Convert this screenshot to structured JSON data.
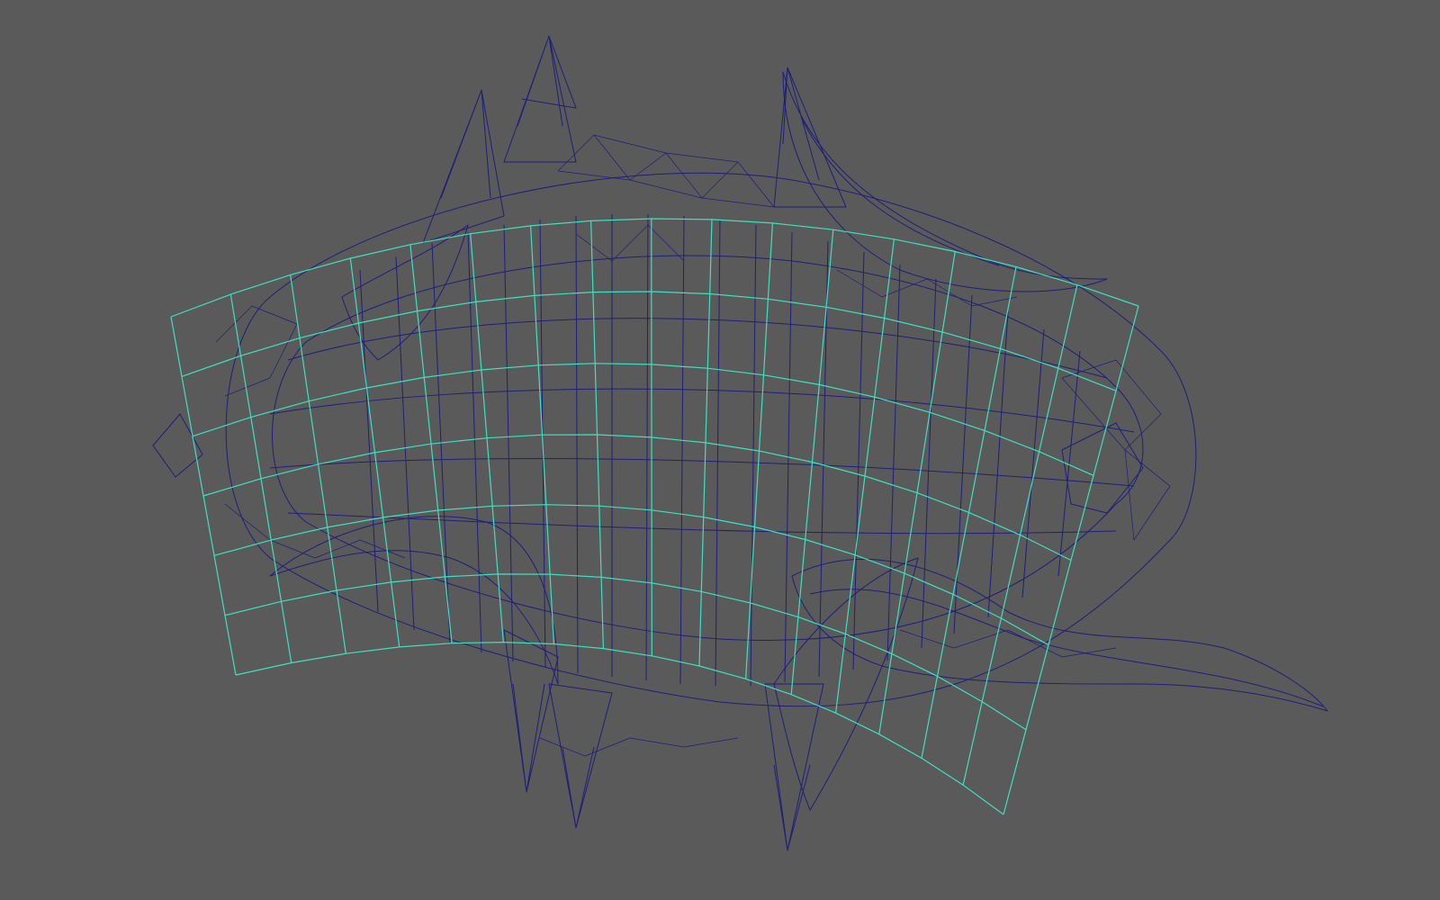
{
  "viewport": {
    "background_color": "#5a5a5a",
    "mesh_wire_color": "#1f1f7a",
    "lattice_color": "#3fe0c0",
    "view_mode": "wireframe"
  },
  "scene": {
    "objects": [
      {
        "semantic": "spiked-ring-mesh",
        "display": "wireframe"
      },
      {
        "semantic": "bend-deformer-lattice",
        "display": "wireframe",
        "rows": 6,
        "columns": 16
      }
    ]
  }
}
